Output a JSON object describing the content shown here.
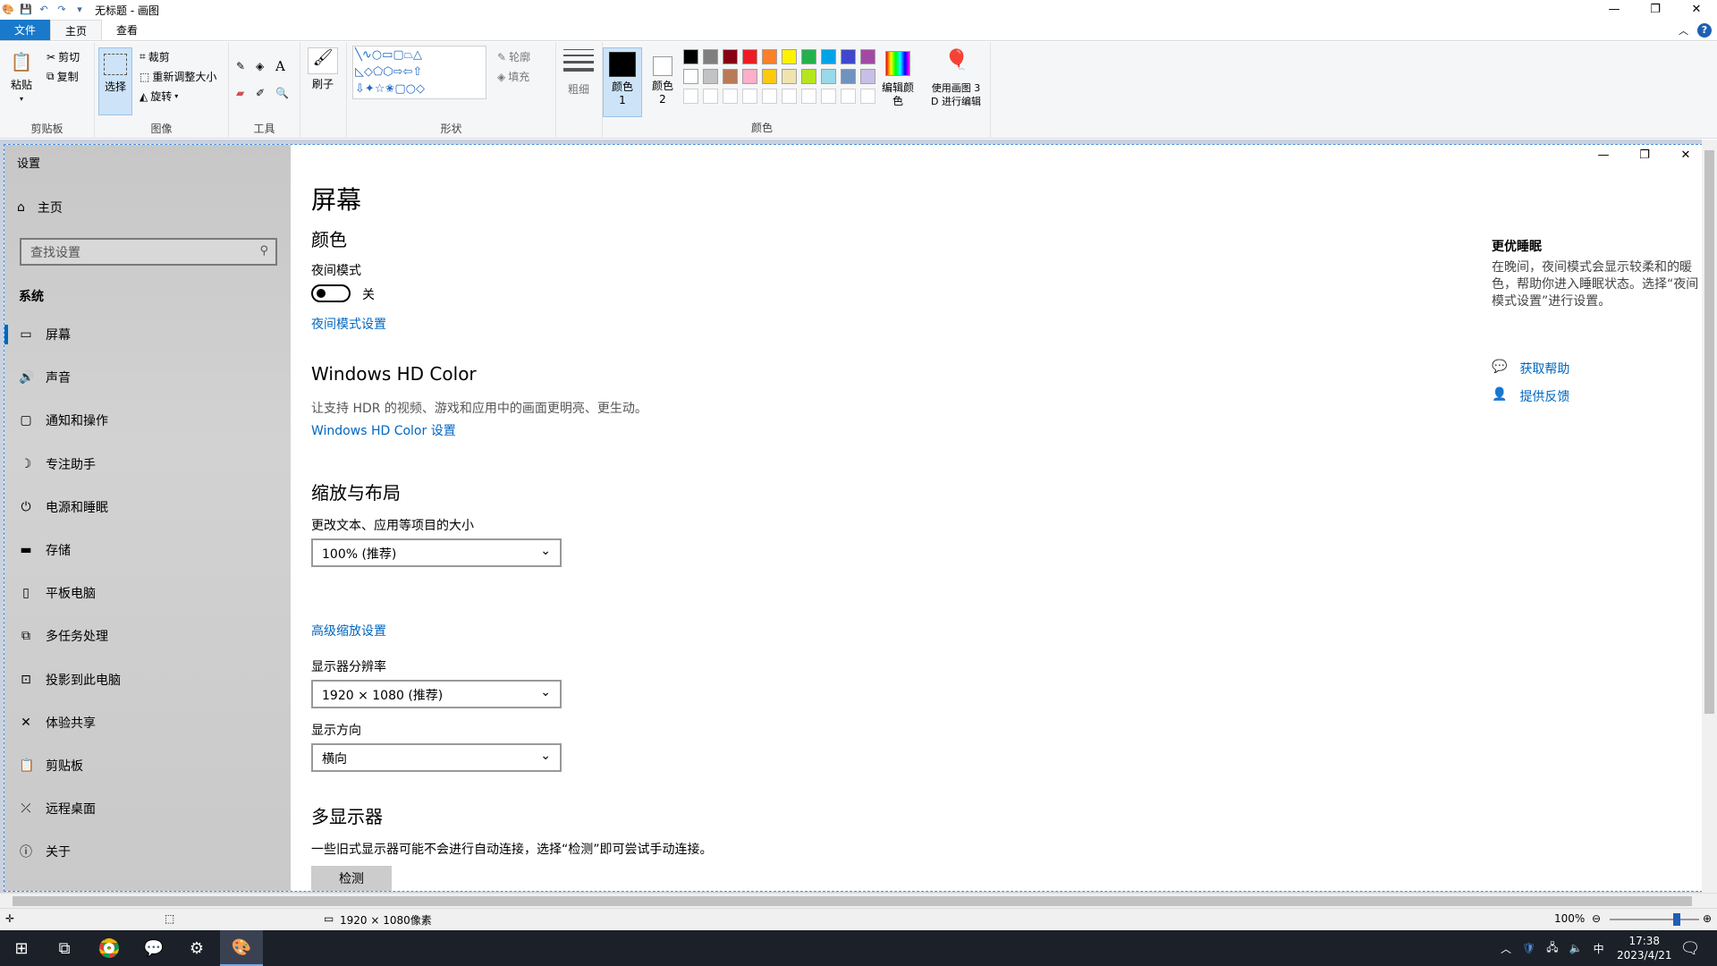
{
  "window": {
    "title": "无标题 - 画图"
  },
  "quick_access": [
    "save-icon",
    "undo-icon",
    "redo-icon",
    "customize-icon"
  ],
  "tabs": [
    "文件",
    "主页",
    "查看"
  ],
  "ribbon": {
    "clipboard": {
      "paste": "粘贴",
      "cut": "剪切",
      "copy": "复制",
      "label": "剪贴板"
    },
    "image": {
      "select": "选择",
      "crop": "裁剪",
      "resize": "重新调整大小",
      "rotate": "旋转",
      "label": "图像"
    },
    "tools": {
      "label": "工具"
    },
    "brush": "刷子",
    "shapes": {
      "outline": "轮廓",
      "fill": "填充",
      "label": "形状"
    },
    "size": "粗细",
    "color1": "颜色 1",
    "color2": "颜色 2",
    "colors": {
      "row1": [
        "#000000",
        "#7f7f7f",
        "#880015",
        "#ed1c24",
        "#ff7f27",
        "#fff200",
        "#22b14c",
        "#00a2e8",
        "#3f48cc",
        "#a349a4"
      ],
      "row2": [
        "#ffffff",
        "#c3c3c3",
        "#b97a57",
        "#ffaec9",
        "#ffc90e",
        "#efe4b0",
        "#b5e61d",
        "#99d9ea",
        "#7092be",
        "#c8bfe7"
      ],
      "label": "颜色"
    },
    "edit_colors": "编辑颜色",
    "paint3d": "使用画图 3 D 进行编辑"
  },
  "settings": {
    "app_title": "设置",
    "home": "主页",
    "search_placeholder": "查找设置",
    "section": "系统",
    "nav": [
      {
        "label": "屏幕",
        "icon": "monitor-icon",
        "selected": true
      },
      {
        "label": "声音",
        "icon": "speaker-icon"
      },
      {
        "label": "通知和操作",
        "icon": "notification-icon"
      },
      {
        "label": "专注助手",
        "icon": "moon-icon"
      },
      {
        "label": "电源和睡眠",
        "icon": "power-icon"
      },
      {
        "label": "存储",
        "icon": "storage-icon"
      },
      {
        "label": "平板电脑",
        "icon": "tablet-icon"
      },
      {
        "label": "多任务处理",
        "icon": "multitask-icon"
      },
      {
        "label": "投影到此电脑",
        "icon": "project-icon"
      },
      {
        "label": "体验共享",
        "icon": "share-icon"
      },
      {
        "label": "剪贴板",
        "icon": "clipboard-icon"
      },
      {
        "label": "远程桌面",
        "icon": "remote-icon"
      },
      {
        "label": "关于",
        "icon": "info-icon"
      }
    ],
    "page_title": "屏幕",
    "color_heading": "颜色",
    "night_mode_label": "夜间模式",
    "night_mode_state": "关",
    "night_mode_link": "夜间模式设置",
    "hd_heading": "Windows HD Color",
    "hd_desc": "让支持 HDR 的视频、游戏和应用中的画面更明亮、更生动。",
    "hd_link": "Windows HD Color 设置",
    "scale_heading": "缩放与布局",
    "scale_label": "更改文本、应用等项目的大小",
    "scale_value": "100% (推荐)",
    "adv_scale_link": "高级缩放设置",
    "resolution_label": "显示器分辨率",
    "resolution_value": "1920 × 1080 (推荐)",
    "orientation_label": "显示方向",
    "orientation_value": "横向",
    "multi_heading": "多显示器",
    "multi_desc": "一些旧式显示器可能不会进行自动连接，选择“检测”即可尝试手动连接。",
    "detect_btn": "检测",
    "side_title": "更优睡眠",
    "side_desc": "在晚间，夜间模式会显示较柔和的暖色，帮助你进入睡眠状态。选择“夜间模式设置”进行设置。",
    "help_link": "获取帮助",
    "feedback_link": "提供反馈"
  },
  "status": {
    "dimensions": "1920 × 1080像素",
    "zoom": "100%",
    "zoom_fraction": 0.75
  },
  "taskbar": {
    "time": "17:38",
    "date": "2023/4/21",
    "ime": "中"
  }
}
